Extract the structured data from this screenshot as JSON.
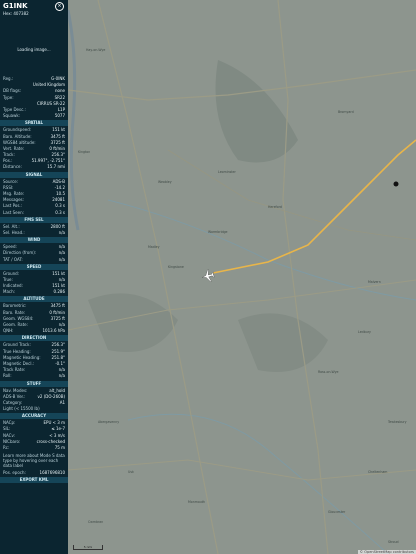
{
  "header": {
    "callsign": "G1INK",
    "hex": "Hex: 407382",
    "close": "×"
  },
  "photo": {
    "loading": "Loading image..."
  },
  "info": [
    {
      "k": "Reg.:",
      "v": "G-0INK"
    },
    {
      "k": "",
      "v": "United Kingdom"
    },
    {
      "k": "DB flags:",
      "v": "none"
    },
    {
      "k": "Type:",
      "v": "SR22"
    },
    {
      "k": "",
      "v": "CIRRUS SR-22"
    },
    {
      "k": "Type Desc.:",
      "v": "L1P"
    },
    {
      "k": "Squawk:",
      "v": "5077"
    }
  ],
  "spatial": {
    "title": "SPATIAL",
    "rows": [
      {
        "k": "Groundspeed:",
        "v": "151 kt"
      },
      {
        "k": "Baro. Altitude:",
        "v": "3475 ft"
      },
      {
        "k": "WGS84 altitude:",
        "v": "3725 ft"
      },
      {
        "k": "Vert. Rate:",
        "v": "0 ft/min"
      },
      {
        "k": "Track:",
        "v": "256.3°"
      },
      {
        "k": "Pos.:",
        "v": "51.997°, -2.751°"
      },
      {
        "k": "Distance:",
        "v": "15.7 nmi"
      }
    ]
  },
  "signal": {
    "title": "SIGNAL",
    "rows": [
      {
        "k": "Source:",
        "v": "ADS-B"
      },
      {
        "k": "RSSI:",
        "v": "-14.2"
      },
      {
        "k": "Msg. Rate:",
        "v": "10.5"
      },
      {
        "k": "Messages:",
        "v": "24081"
      },
      {
        "k": "Last Pos.:",
        "v": "0.3 s"
      },
      {
        "k": "Last Seen:",
        "v": "0.3 s"
      }
    ]
  },
  "fmssel": {
    "title": "FMS SEL",
    "rows": [
      {
        "k": "Sel. Alt.:",
        "v": "2800 ft"
      },
      {
        "k": "Sel. Head.:",
        "v": "n/a"
      }
    ]
  },
  "wind": {
    "title": "WIND",
    "rows": [
      {
        "k": "Speed:",
        "v": "n/a"
      },
      {
        "k": "Direction (from):",
        "v": "n/a"
      },
      {
        "k": "TAT / OAT:",
        "v": "n/a"
      }
    ]
  },
  "speed": {
    "title": "SPEED",
    "rows": [
      {
        "k": "Ground:",
        "v": "151 kt"
      },
      {
        "k": "True:",
        "v": "n/a"
      },
      {
        "k": "Indicated:",
        "v": "151 kt"
      },
      {
        "k": "Mach:",
        "v": "0.286"
      }
    ]
  },
  "altitude": {
    "title": "ALTITUDE",
    "rows": [
      {
        "k": "Barometric:",
        "v": "3475 ft"
      },
      {
        "k": "Baro. Rate:",
        "v": "0 ft/min"
      },
      {
        "k": "Geom. WGS84:",
        "v": "3725 ft"
      },
      {
        "k": "Geom. Rate:",
        "v": "n/a"
      },
      {
        "k": "QNH:",
        "v": "1013.6 hPa"
      }
    ]
  },
  "direction": {
    "title": "DIRECTION",
    "rows": [
      {
        "k": "Ground Track:",
        "v": "256.3°"
      },
      {
        "k": "True Heading:",
        "v": "251.9°"
      },
      {
        "k": "Magnetic Heading:",
        "v": "251.8°"
      },
      {
        "k": "Magnetic Decl.:",
        "v": "-0.1°"
      },
      {
        "k": "Track Rate:",
        "v": "n/a"
      },
      {
        "k": "Roll:",
        "v": "n/a"
      }
    ]
  },
  "stuff": {
    "title": "STUFF",
    "rows": [
      {
        "k": "Nav. Modes:",
        "v": "alt_hold"
      },
      {
        "k": "ADS-B Ver.:",
        "v": "v2 (DO-260B)"
      },
      {
        "k": "Category:",
        "v": "A1"
      },
      {
        "k": "Light (< 15500 lb)",
        "v": ""
      }
    ]
  },
  "accuracy": {
    "title": "ACCURACY",
    "rows": [
      {
        "k": "NACp:",
        "v": "EPU < 3 m"
      },
      {
        "k": "SIL:",
        "v": "≤ 1e-7"
      },
      {
        "k": "NACv:",
        "v": "< 3 m/s"
      },
      {
        "k": "NICbaro:",
        "v": "cross-checked"
      },
      {
        "k": "Rc:",
        "v": "75 m"
      }
    ]
  },
  "note": "Learn more about Mode S data type by hovering over each data label",
  "pos_epoch": {
    "k": "Pos. epoch:",
    "v": "1687696810"
  },
  "export": "EXPORT KML",
  "map": {
    "attribution": "© OpenStreetMap contributors",
    "scale": "5 nmi",
    "place_labels": [
      "Hay-on-Wye",
      "Wormbridge",
      "Kingstone",
      "Hereford",
      "Madley",
      "Abergavenny",
      "Ross-on-Wye",
      "Monmouth",
      "Ledbury",
      "Bromyard",
      "Kington",
      "Leominster",
      "Weobley",
      "Cwmbran",
      "Usk",
      "Malvern",
      "Tewkesbury",
      "Cheltenham",
      "Gloucester",
      "Stroud"
    ],
    "colors": {
      "track": "#e8b54a",
      "map_bg": "#8d958e"
    }
  }
}
